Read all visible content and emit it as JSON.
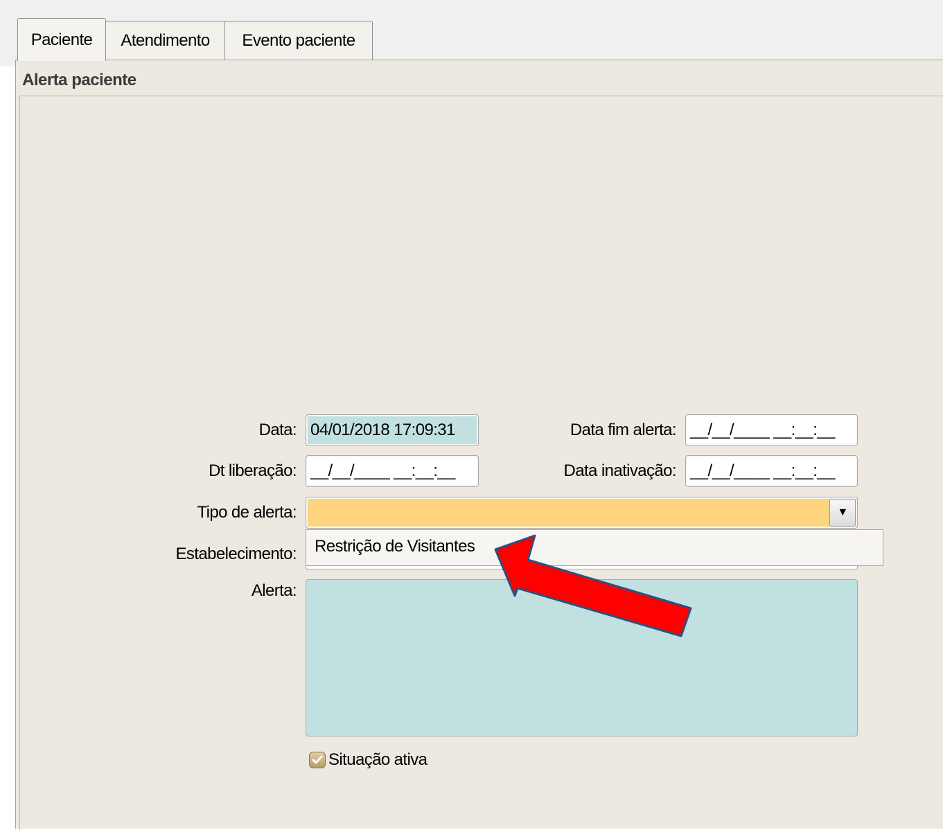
{
  "tabs": [
    {
      "label": "Paciente",
      "active": true
    },
    {
      "label": "Atendimento",
      "active": false
    },
    {
      "label": "Evento paciente",
      "active": false
    }
  ],
  "section": {
    "title": "Alerta paciente"
  },
  "form": {
    "data_label": "Data:",
    "data_value": "04/01/2018 17:09:31",
    "data_fim_label": "Data fim alerta:",
    "data_fim_value": "__/__/____ __:__:__",
    "dt_liberacao_label": "Dt liberação:",
    "dt_liberacao_value": "__/__/____ __:__:__",
    "data_inativacao_label": "Data inativação:",
    "data_inativacao_value": "__/__/____ __:__:__",
    "tipo_alerta_label": "Tipo de alerta:",
    "tipo_alerta_value": "",
    "estabelecimento_label": "Estabelecimento:",
    "alerta_label": "Alerta:",
    "alerta_value": "",
    "situacao_label": "Situação ativa",
    "situacao_checked": true
  },
  "dropdown": {
    "options": [
      "Restrição de Visitantes"
    ]
  },
  "colors": {
    "readonly_field": "#c1e0e0",
    "required_combo": "#ffd47e",
    "panel_bg": "#ede8e0",
    "annotation_arrow": "#ff0000"
  }
}
